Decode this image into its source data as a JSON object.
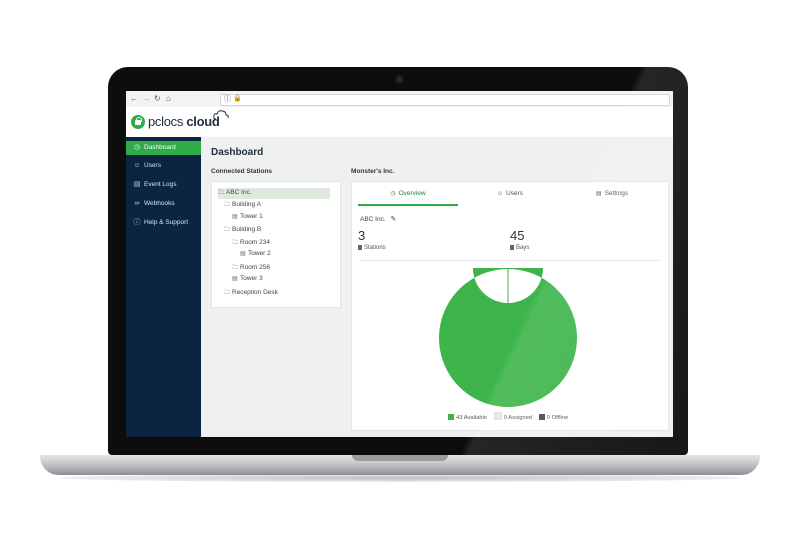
{
  "browser": {
    "back_icon": "arrow-left-icon",
    "forward_icon": "arrow-right-icon",
    "reload_icon": "reload-icon",
    "home_icon": "home-icon"
  },
  "app": {
    "logo_prefix": "pclocs",
    "logo_suffix": "cloud",
    "accent_color": "#2eac4a",
    "sidebar_color": "#0b2540"
  },
  "sidebar": {
    "items": [
      {
        "label": "Dashboard",
        "icon": "dashboard-icon",
        "active": true
      },
      {
        "label": "Users",
        "icon": "user-icon",
        "active": false
      },
      {
        "label": "Event Logs",
        "icon": "document-icon",
        "active": false
      },
      {
        "label": "Webhooks",
        "icon": "link-icon",
        "active": false
      },
      {
        "label": "Help & Support",
        "icon": "help-icon",
        "active": false
      }
    ]
  },
  "main": {
    "title": "Dashboard",
    "connected_label": "Connected Stations",
    "selected_org_label": "Monster's Inc.",
    "tree": [
      {
        "label": "ABC Inc.",
        "icon": "folder-icon",
        "level": 0,
        "selected": true
      },
      {
        "label": "Building A",
        "icon": "folder-icon",
        "level": 1
      },
      {
        "label": "Tower 1",
        "icon": "station-icon",
        "level": 2
      },
      {
        "label": "Building B",
        "icon": "folder-icon",
        "level": 1
      },
      {
        "label": "Room 234",
        "icon": "folder-icon",
        "level": 2
      },
      {
        "label": "Tower 2",
        "icon": "station-icon",
        "level": 3
      },
      {
        "label": "Room 256",
        "icon": "folder-icon",
        "level": 2
      },
      {
        "label": "Tower 3",
        "icon": "station-icon",
        "level": 2
      },
      {
        "label": "Reception Desk",
        "icon": "folder-icon",
        "level": 1
      }
    ],
    "tabs": [
      {
        "label": "Overview",
        "icon": "clock-icon",
        "active": true
      },
      {
        "label": "Users",
        "icon": "user-icon",
        "active": false
      },
      {
        "label": "Settings",
        "icon": "settings-icon",
        "active": false
      }
    ],
    "org_name": "ABC Inc.",
    "stats": [
      {
        "value": "3",
        "label": "Stations"
      },
      {
        "value": "45",
        "label": "Bays"
      }
    ],
    "legend": [
      {
        "label": "43 Available",
        "color": "#3db54a"
      },
      {
        "label": "0 Assigned",
        "color": "#e8e8e8"
      },
      {
        "label": "0 Offline",
        "color": "#4a4a4a"
      }
    ]
  },
  "chart_data": {
    "type": "pie",
    "categories": [
      "Available",
      "Assigned",
      "Offline"
    ],
    "values": [
      43,
      0,
      0
    ],
    "colors": [
      "#3db54a",
      "#e8e8e8",
      "#4a4a4a"
    ],
    "legend_position": "bottom"
  }
}
